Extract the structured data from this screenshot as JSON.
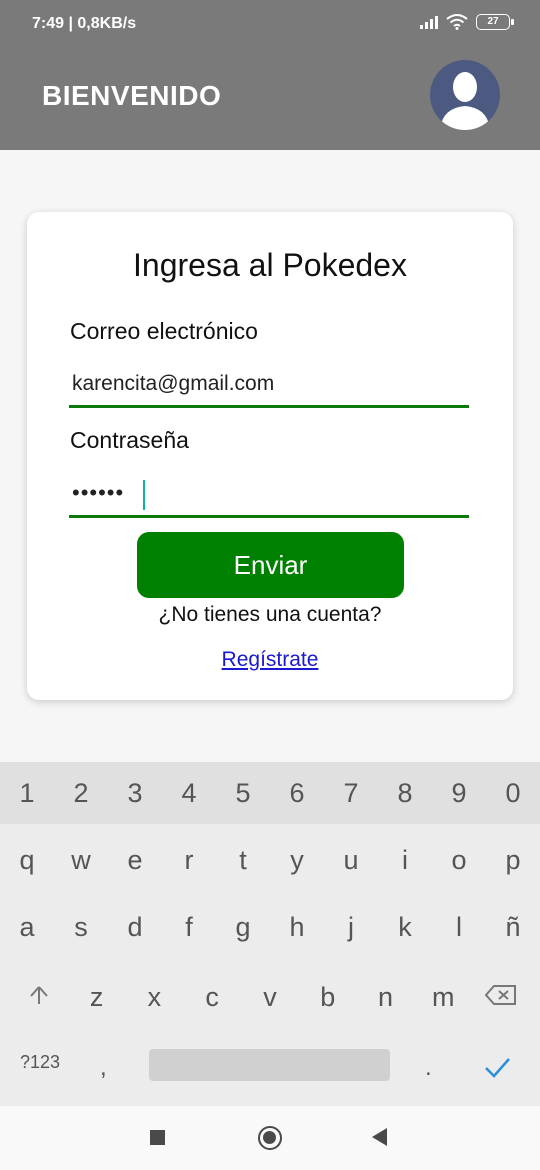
{
  "status_bar": {
    "time_speed": "7:49 | 0,8KB/s",
    "battery": "27"
  },
  "app_bar": {
    "title": "BIENVENIDO",
    "avatar_icon": "user-avatar-icon"
  },
  "login": {
    "title": "Ingresa al Pokedex",
    "email_label": "Correo electrónico",
    "email_value": "karencita@gmail.com",
    "password_label": "Contraseña",
    "password_value": "••••••",
    "submit_label": "Enviar",
    "no_account_text": "¿No tienes una cuenta?",
    "register_link": "Regístrate"
  },
  "keyboard": {
    "numbers": [
      "1",
      "2",
      "3",
      "4",
      "5",
      "6",
      "7",
      "8",
      "9",
      "0"
    ],
    "row1": [
      "q",
      "w",
      "e",
      "r",
      "t",
      "y",
      "u",
      "i",
      "o",
      "p"
    ],
    "row2": [
      "a",
      "s",
      "d",
      "f",
      "g",
      "h",
      "j",
      "k",
      "l",
      "ñ"
    ],
    "row3": [
      "z",
      "x",
      "c",
      "v",
      "b",
      "n",
      "m"
    ],
    "symbols_key": "?123",
    "comma_key": ",",
    "period_key": "."
  },
  "colors": {
    "app_bar": "#7a7a7a",
    "accent_green": "#008000",
    "link_blue": "#1a1ad2",
    "cursor": "#0bb3a0"
  }
}
